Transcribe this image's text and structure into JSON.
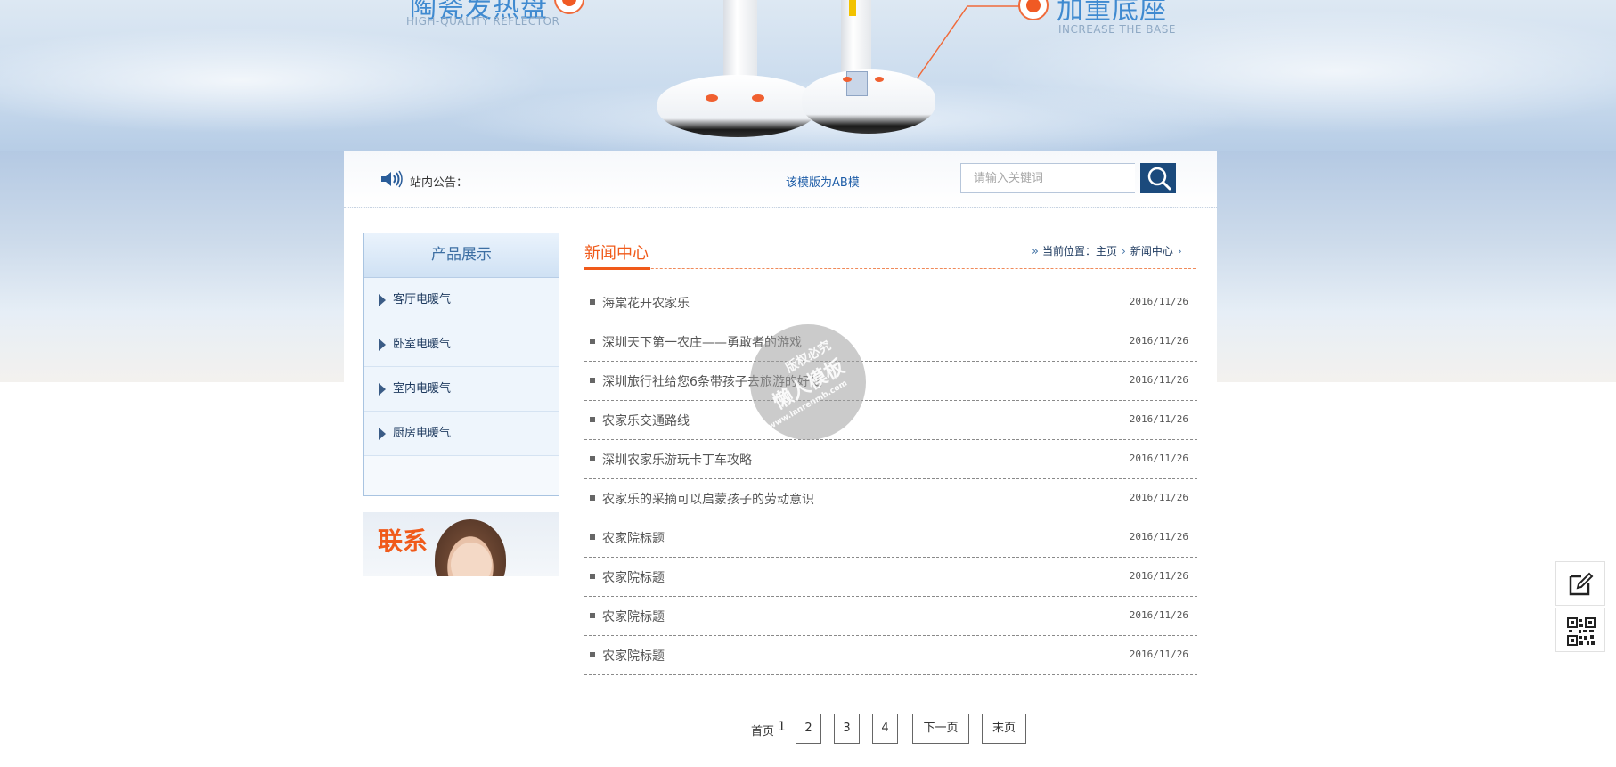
{
  "hero": {
    "title_left": "陶瓷发热盘",
    "subtitle_left": "HIGH-QUALITY REFLECTOR",
    "title_right": "加重底座",
    "subtitle_right": "INCREASE THE BASE"
  },
  "notice": {
    "label": "站内公告：",
    "text": "该模版为AB模"
  },
  "search": {
    "placeholder": "请输入关键词"
  },
  "sidebar": {
    "title": "产品展示",
    "items": [
      {
        "label": "客厅电暖气"
      },
      {
        "label": "卧室电暖气"
      },
      {
        "label": "室内电暖气"
      },
      {
        "label": "厨房电暖气"
      }
    ],
    "contact_text": "联系"
  },
  "news": {
    "title": "新闻中心",
    "breadcrumb": {
      "prefix": "当前位置：",
      "home": "主页",
      "current": "新闻中心"
    },
    "items": [
      {
        "title": "海棠花开农家乐",
        "date": "2016/11/26"
      },
      {
        "title": "深圳天下第一农庄——勇敢者的游戏",
        "date": "2016/11/26"
      },
      {
        "title": "深圳旅行社给您6条带孩子去旅游的好处",
        "date": "2016/11/26"
      },
      {
        "title": "农家乐交通路线",
        "date": "2016/11/26"
      },
      {
        "title": "深圳农家乐游玩卡丁车攻略",
        "date": "2016/11/26"
      },
      {
        "title": "农家乐的采摘可以启蒙孩子的劳动意识",
        "date": "2016/11/26"
      },
      {
        "title": "农家院标题",
        "date": "2016/11/26"
      },
      {
        "title": "农家院标题",
        "date": "2016/11/26"
      },
      {
        "title": "农家院标题",
        "date": "2016/11/26"
      },
      {
        "title": "农家院标题",
        "date": "2016/11/26"
      }
    ]
  },
  "pagination": {
    "first": "首页",
    "current": "1",
    "pages": [
      "2",
      "3",
      "4"
    ],
    "next": "下一页",
    "last": "末页"
  },
  "watermark": {
    "line1": "版权必究",
    "line2": "懒人模板",
    "line3": "www.lanrenmb.com"
  },
  "colors": {
    "accent": "#f05a1a",
    "brand_blue": "#1b4a7c",
    "link_blue": "#1f5ea8"
  },
  "icons": {
    "notice": "speaker-icon",
    "search": "search-icon",
    "feedback": "edit-icon",
    "qr": "qr-code-icon"
  }
}
